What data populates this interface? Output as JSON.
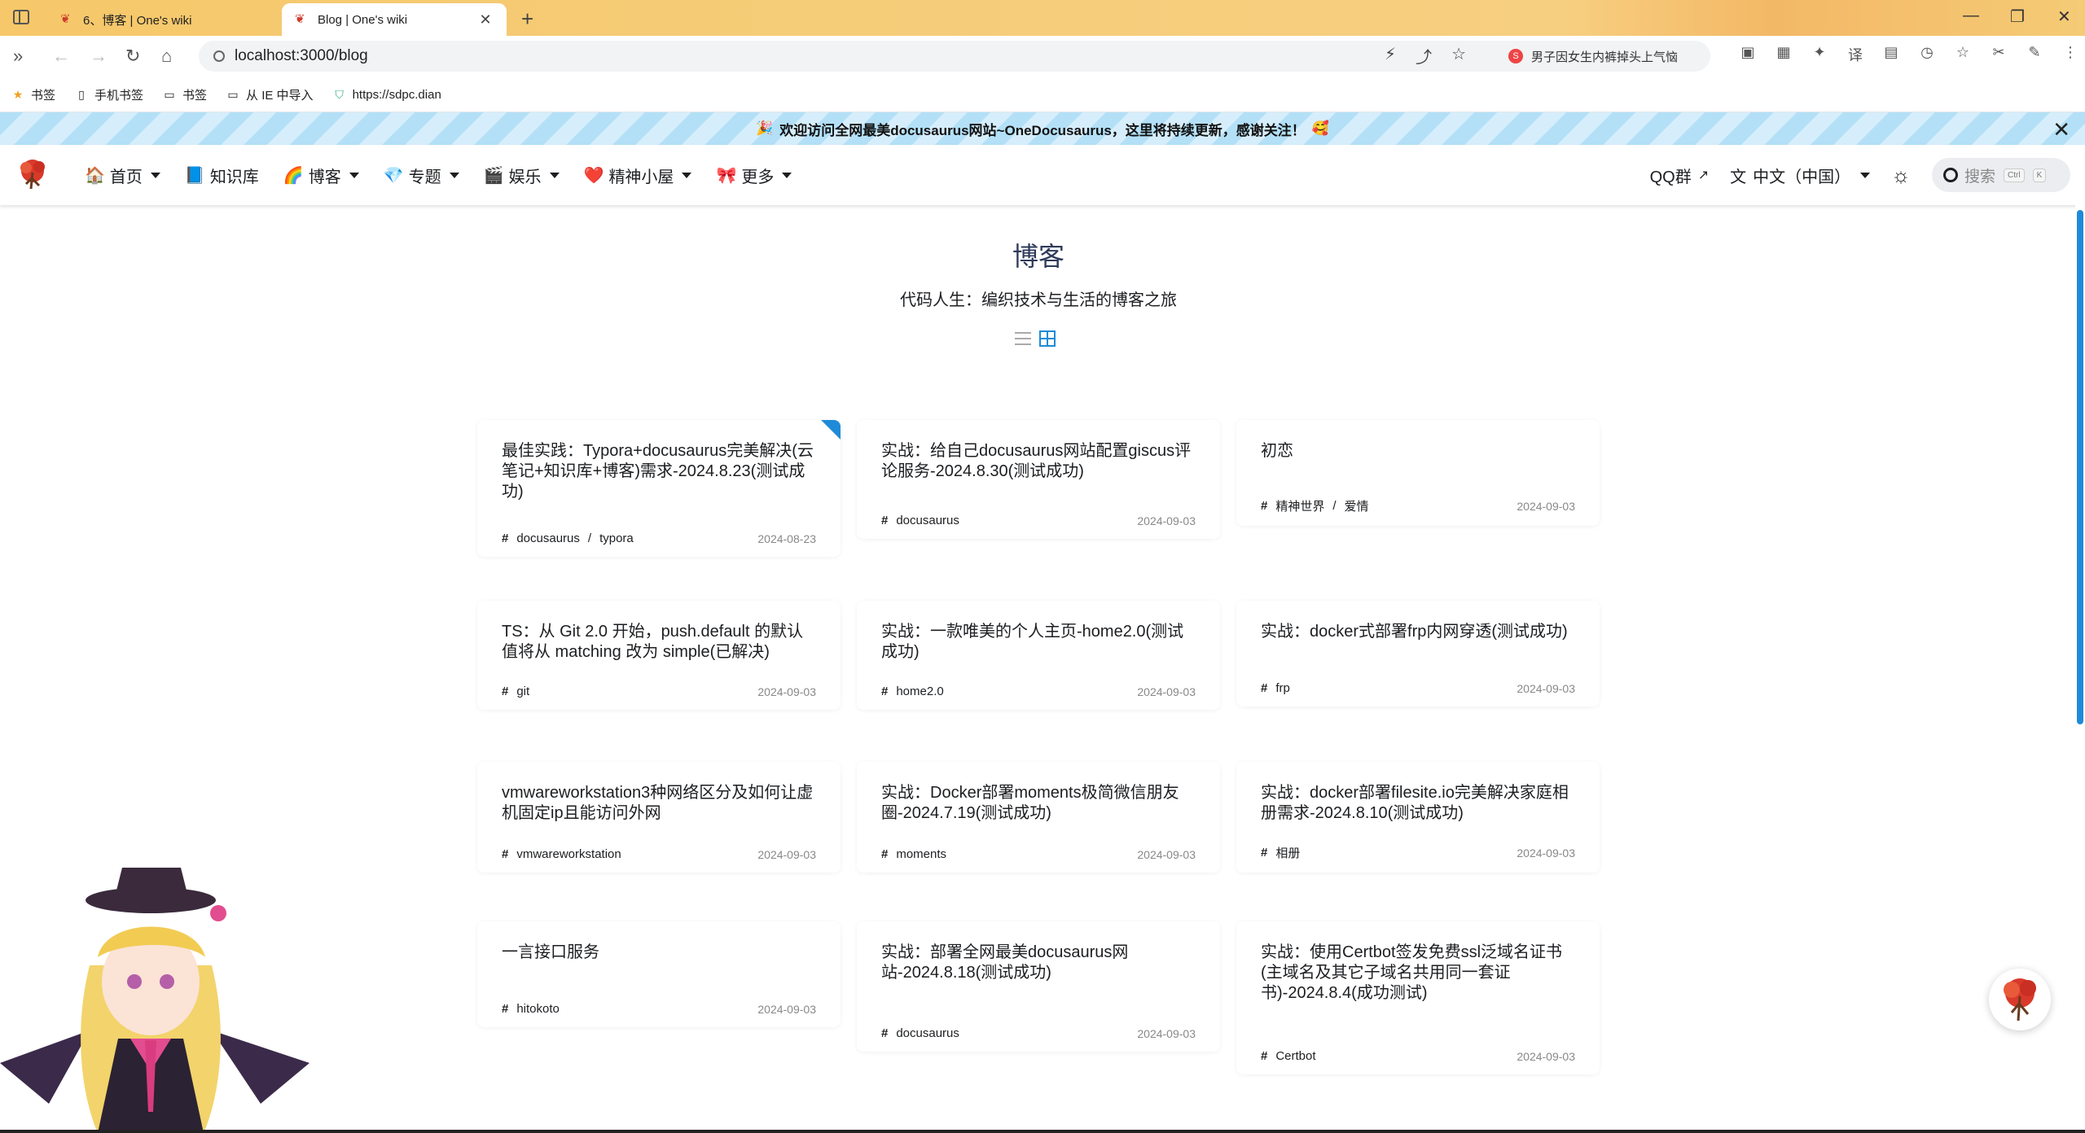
{
  "browser": {
    "tabs": [
      {
        "title": "6、博客 | One's wiki",
        "active": false
      },
      {
        "title": "Blog | One's wiki",
        "active": true
      }
    ],
    "url": "localhost:3000/blog",
    "hot_search": "男子因女生内裤掉头上气恼",
    "bookmarks": [
      "书签",
      "手机书签",
      "书签",
      "从 IE 中导入",
      "https://sdpc.dian"
    ]
  },
  "announcement": "欢迎访问全网最美docusaurus网站~OneDocusaurus，这里将持续更新，感谢关注！",
  "navbar": {
    "items": [
      {
        "label": "首页",
        "icon": "🏠",
        "dropdown": true
      },
      {
        "label": "知识库",
        "icon": "📘",
        "dropdown": false
      },
      {
        "label": "博客",
        "icon": "🌈",
        "dropdown": true
      },
      {
        "label": "专题",
        "icon": "💎",
        "dropdown": true
      },
      {
        "label": "娱乐",
        "icon": "🎬",
        "dropdown": true
      },
      {
        "label": "精神小屋",
        "icon": "❤️",
        "dropdown": true
      },
      {
        "label": "更多",
        "icon": "🎀",
        "dropdown": true
      }
    ],
    "qq": "QQ群",
    "locale": "中文（中国）",
    "search_placeholder": "搜索",
    "search_kbd": [
      "Ctrl",
      "K"
    ]
  },
  "page": {
    "title": "博客",
    "subtitle": "代码人生：编织技术与生活的博客之旅"
  },
  "posts": [
    {
      "title": "最佳实践：Typora+docusaurus完美解决(云笔记+知识库+博客)需求-2024.8.23(测试成功)",
      "tags": [
        "docusaurus",
        "typora"
      ],
      "date": "2024-08-23",
      "pinned": true
    },
    {
      "title": "实战：给自己docusaurus网站配置giscus评论服务-2024.8.30(测试成功)",
      "tags": [
        "docusaurus"
      ],
      "date": "2024-09-03",
      "pinned": false
    },
    {
      "title": "初恋",
      "tags": [
        "精神世界",
        "爱情"
      ],
      "date": "2024-09-03",
      "pinned": false
    },
    {
      "title": "TS：从 Git 2.0 开始，push.default 的默认值将从 matching 改为 simple(已解决)",
      "tags": [
        "git"
      ],
      "date": "2024-09-03",
      "pinned": false
    },
    {
      "title": "实战：一款唯美的个人主页-home2.0(测试成功)",
      "tags": [
        "home2.0"
      ],
      "date": "2024-09-03",
      "pinned": false
    },
    {
      "title": "实战：docker式部署frp内网穿透(测试成功)",
      "tags": [
        "frp"
      ],
      "date": "2024-09-03",
      "pinned": false
    },
    {
      "title": "vmwareworkstation3种网络区分及如何让虚机固定ip且能访问外网",
      "tags": [
        "vmwareworkstation"
      ],
      "date": "2024-09-03",
      "pinned": false
    },
    {
      "title": "实战：Docker部署moments极简微信朋友圈-2024.7.19(测试成功)",
      "tags": [
        "moments"
      ],
      "date": "2024-09-03",
      "pinned": false
    },
    {
      "title": "实战：docker部署filesite.io完美解决家庭相册需求-2024.8.10(测试成功)",
      "tags": [
        "相册"
      ],
      "date": "2024-09-03",
      "pinned": false
    },
    {
      "title": "一言接口服务",
      "tags": [
        "hitokoto"
      ],
      "date": "2024-09-03",
      "pinned": false
    },
    {
      "title": "实战：部署全网最美docusaurus网站-2024.8.18(测试成功)",
      "tags": [
        "docusaurus"
      ],
      "date": "2024-09-03",
      "pinned": false
    },
    {
      "title": "实战：使用Certbot签发免费ssl泛域名证书(主域名及其它子域名共用同一套证书)-2024.8.4(成功测试)",
      "tags": [
        "Certbot"
      ],
      "date": "2024-09-03",
      "pinned": false
    }
  ]
}
